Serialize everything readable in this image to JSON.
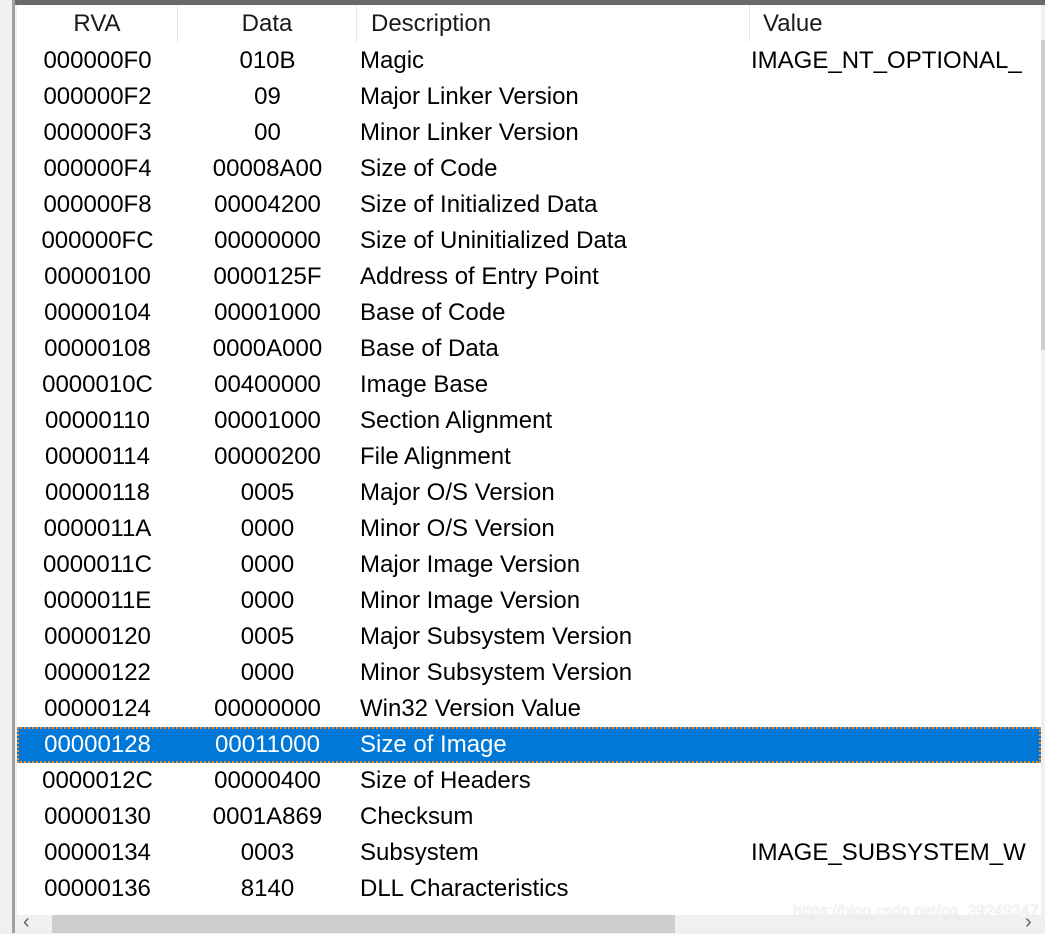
{
  "columns": {
    "rva": "RVA",
    "data": "Data",
    "description": "Description",
    "value": "Value"
  },
  "rows": [
    {
      "rva": "000000F0",
      "data": "010B",
      "description": "Magic",
      "value": "IMAGE_NT_OPTIONAL_"
    },
    {
      "rva": "000000F2",
      "data": "09",
      "description": "Major Linker Version",
      "value": ""
    },
    {
      "rva": "000000F3",
      "data": "00",
      "description": "Minor Linker Version",
      "value": ""
    },
    {
      "rva": "000000F4",
      "data": "00008A00",
      "description": "Size of Code",
      "value": ""
    },
    {
      "rva": "000000F8",
      "data": "00004200",
      "description": "Size of Initialized Data",
      "value": ""
    },
    {
      "rva": "000000FC",
      "data": "00000000",
      "description": "Size of Uninitialized Data",
      "value": ""
    },
    {
      "rva": "00000100",
      "data": "0000125F",
      "description": "Address of Entry Point",
      "value": ""
    },
    {
      "rva": "00000104",
      "data": "00001000",
      "description": "Base of Code",
      "value": ""
    },
    {
      "rva": "00000108",
      "data": "0000A000",
      "description": "Base of Data",
      "value": ""
    },
    {
      "rva": "0000010C",
      "data": "00400000",
      "description": "Image Base",
      "value": ""
    },
    {
      "rva": "00000110",
      "data": "00001000",
      "description": "Section Alignment",
      "value": ""
    },
    {
      "rva": "00000114",
      "data": "00000200",
      "description": "File Alignment",
      "value": ""
    },
    {
      "rva": "00000118",
      "data": "0005",
      "description": "Major O/S Version",
      "value": ""
    },
    {
      "rva": "0000011A",
      "data": "0000",
      "description": "Minor O/S Version",
      "value": ""
    },
    {
      "rva": "0000011C",
      "data": "0000",
      "description": "Major Image Version",
      "value": ""
    },
    {
      "rva": "0000011E",
      "data": "0000",
      "description": "Minor Image Version",
      "value": ""
    },
    {
      "rva": "00000120",
      "data": "0005",
      "description": "Major Subsystem Version",
      "value": ""
    },
    {
      "rva": "00000122",
      "data": "0000",
      "description": "Minor Subsystem Version",
      "value": ""
    },
    {
      "rva": "00000124",
      "data": "00000000",
      "description": "Win32 Version Value",
      "value": ""
    },
    {
      "rva": "00000128",
      "data": "00011000",
      "description": "Size of Image",
      "value": "",
      "selected": true
    },
    {
      "rva": "0000012C",
      "data": "00000400",
      "description": "Size of Headers",
      "value": ""
    },
    {
      "rva": "00000130",
      "data": "0001A869",
      "description": "Checksum",
      "value": ""
    },
    {
      "rva": "00000134",
      "data": "0003",
      "description": "Subsystem",
      "value": "IMAGE_SUBSYSTEM_W"
    },
    {
      "rva": "00000136",
      "data": "8140",
      "description": "DLL Characteristics",
      "value": ""
    }
  ],
  "selected_color": "#0078d7",
  "scrollbar": {
    "left_arrow": "‹",
    "right_arrow": "›"
  },
  "watermark": "https://blog.csdn.net/qq_39249347"
}
